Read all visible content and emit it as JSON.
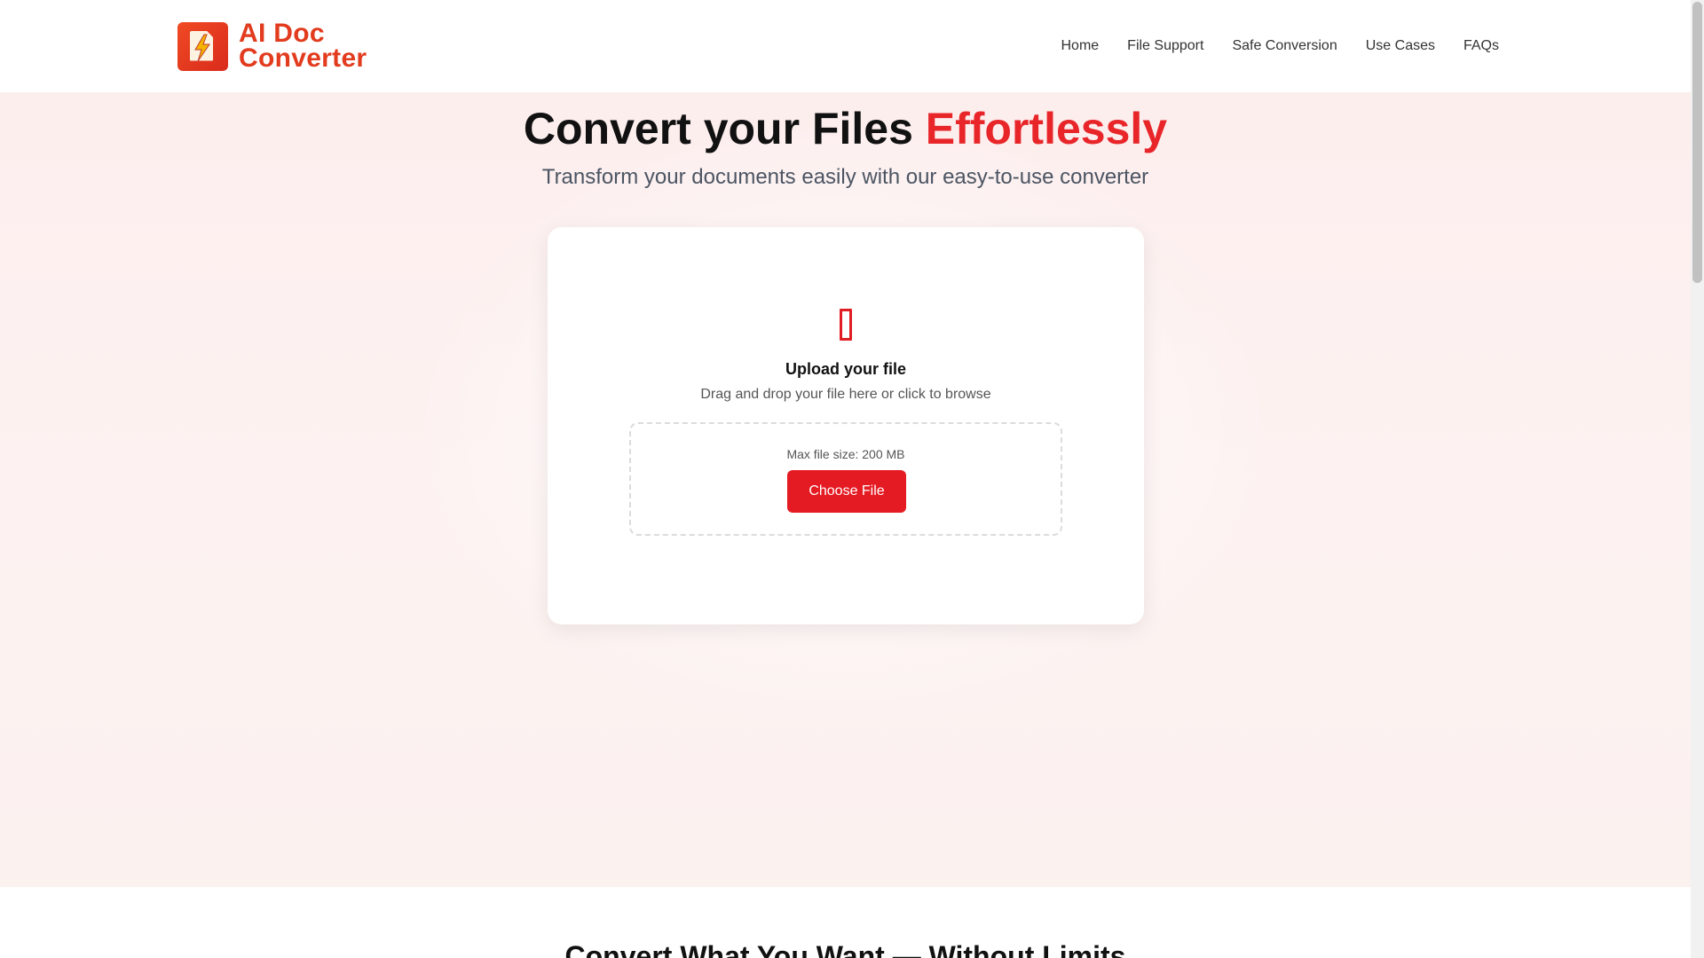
{
  "brand": {
    "name_line1": "AI Doc",
    "name_line2": "Converter",
    "colors": {
      "accent": "#e51b23",
      "logo": "#e23b1e"
    }
  },
  "nav": {
    "items": [
      {
        "label": "Home"
      },
      {
        "label": "File Support"
      },
      {
        "label": "Safe Conversion"
      },
      {
        "label": "Use Cases"
      },
      {
        "label": "FAQs"
      }
    ]
  },
  "hero": {
    "title_main": "Convert your Files ",
    "title_accent": "Effortlessly",
    "subtitle": "Transform your documents easily with our easy-to-use converter"
  },
  "upload": {
    "icon": "file-icon",
    "title": "Upload your file",
    "subtitle": "Drag and drop your file here or click to browse",
    "max_size": "Max file size: 200 MB",
    "button_label": "Choose File"
  },
  "next_section": {
    "title": "Convert What You Want — Without Limits"
  }
}
